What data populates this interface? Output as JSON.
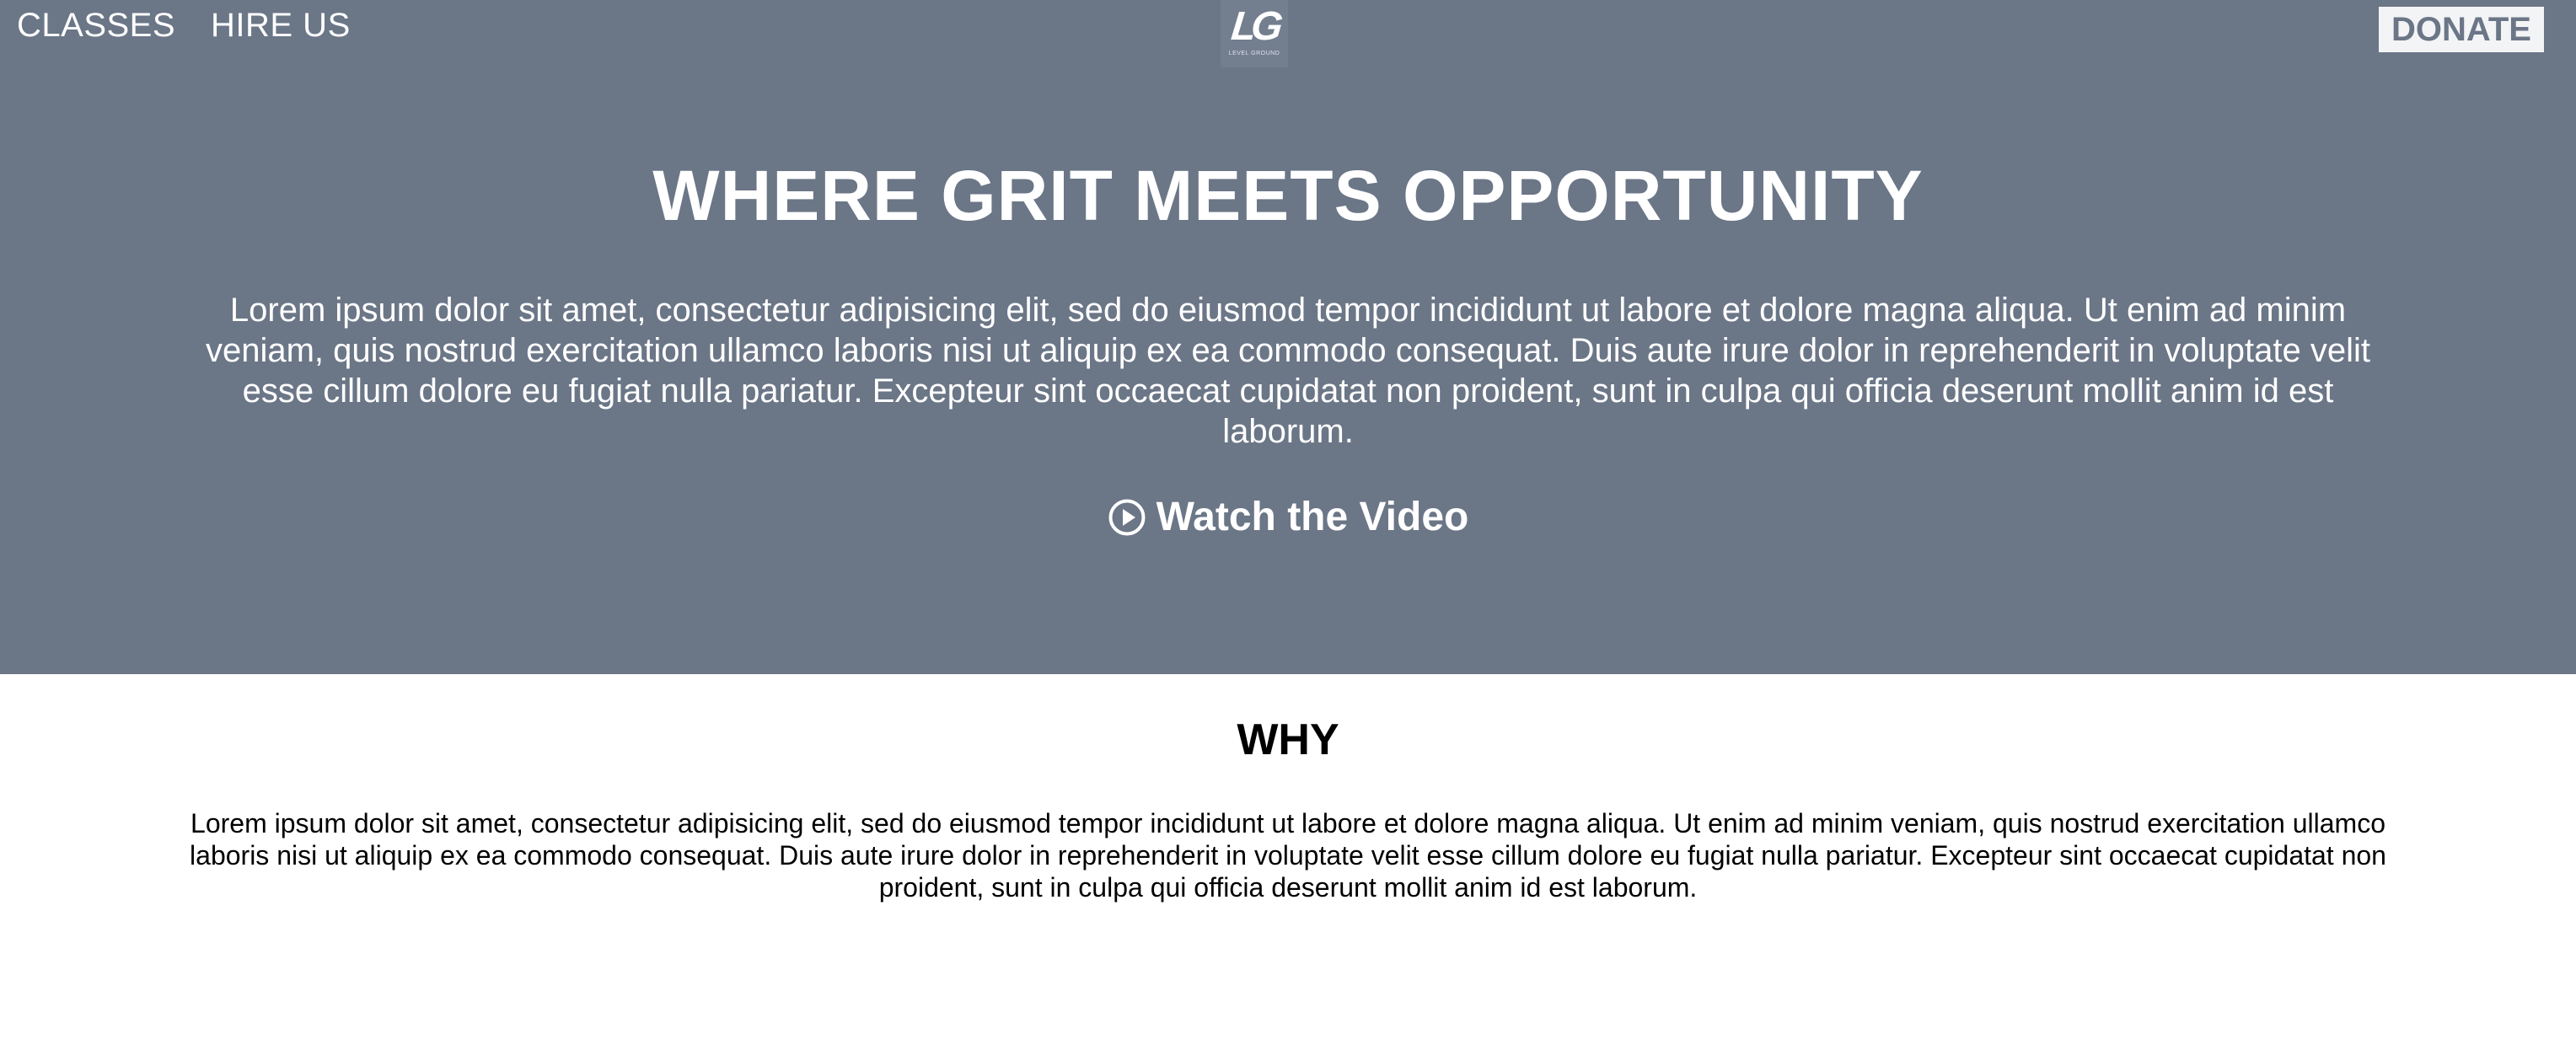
{
  "nav": {
    "classes_label": "CLASSES",
    "hire_label": "HIRE US",
    "donate_label": "DONATE"
  },
  "logo": {
    "mark": "LG",
    "caption": "LEVEL GROUND"
  },
  "hero": {
    "title": "WHERE GRIT MEETS OPPORTUNITY",
    "text": "Lorem ipsum dolor sit amet, consectetur adipisicing elit, sed do eiusmod tempor incididunt ut labore et dolore magna aliqua. Ut enim ad minim veniam, quis nostrud exercitation ullamco laboris nisi ut aliquip ex ea commodo consequat. Duis aute irure dolor in reprehenderit in voluptate velit esse cillum dolore eu fugiat nulla pariatur. Excepteur sint occaecat cupidatat non proident, sunt in culpa qui officia deserunt mollit anim id est laborum.",
    "video_label": "Watch the Video",
    "video_icon": "play-circle-icon"
  },
  "why": {
    "title": "WHY",
    "text": "Lorem ipsum dolor sit amet, consectetur adipisicing elit, sed do eiusmod tempor incididunt ut labore et dolore magna aliqua. Ut enim ad minim veniam, quis nostrud exercitation ullamco laboris nisi ut aliquip ex ea commodo consequat. Duis aute irure dolor in reprehenderit in voluptate velit esse cillum dolore eu fugiat nulla pariatur. Excepteur sint occaecat cupidatat non proident, sunt in culpa qui officia deserunt mollit anim id est laborum."
  },
  "colors": {
    "hero_background": "#6b7687",
    "donate_background": "#f3f4f6",
    "donate_text": "#6b7687",
    "text_light": "#ffffff",
    "text_dark": "#000000"
  }
}
